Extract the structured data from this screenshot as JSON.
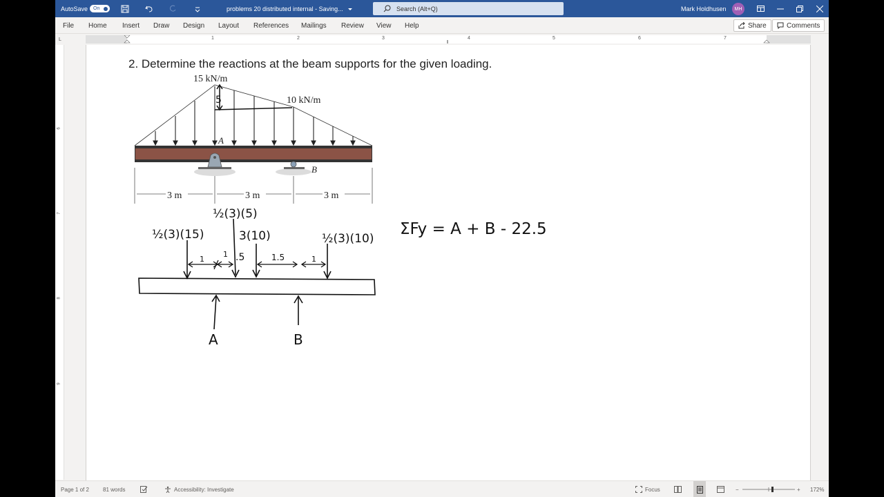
{
  "titlebar": {
    "autosave_label": "AutoSave",
    "autosave_state": "On",
    "doc_title": "problems 20 distributed internal  -  Saving...",
    "search_placeholder": "Search (Alt+Q)",
    "user_name": "Mark Holdhusen",
    "user_initials": "MH"
  },
  "ribbon": {
    "tabs": [
      "File",
      "Home",
      "Insert",
      "Draw",
      "Design",
      "Layout",
      "References",
      "Mailings",
      "Review",
      "View",
      "Help"
    ],
    "share_label": "Share",
    "comments_label": "Comments"
  },
  "ruler": {
    "h_numbers": [
      "1",
      "2",
      "3",
      "4",
      "5",
      "6",
      "7"
    ],
    "v_numbers": [
      "6",
      "7",
      "8",
      "9"
    ]
  },
  "document": {
    "question": "2. Determine the reactions at the beam supports for the given loading.",
    "figure": {
      "load_left_label": "15 kN/m",
      "load_right_label": "10 kN/m",
      "height_mark": "5",
      "support_a": "A",
      "support_b": "B",
      "spans": [
        "3 m",
        "3 m",
        "3 m"
      ]
    },
    "notes": {
      "force1_label": "½(3)(15)",
      "force2_label": "½(3)(5)",
      "force3_label": "3(10)",
      "force4_label": "½(3)(10)",
      "dim_1": "1",
      "dim_2": "1",
      "dim_3": ".5",
      "dim_4": "1.5",
      "dim_5": "1",
      "reaction_a": "A",
      "reaction_b": "B",
      "equation": "ΣFy = A + B - 22.5"
    }
  },
  "statusbar": {
    "page": "Page 1 of 2",
    "words": "81 words",
    "accessibility": "Accessibility: Investigate",
    "focus": "Focus",
    "zoom": "172%"
  }
}
